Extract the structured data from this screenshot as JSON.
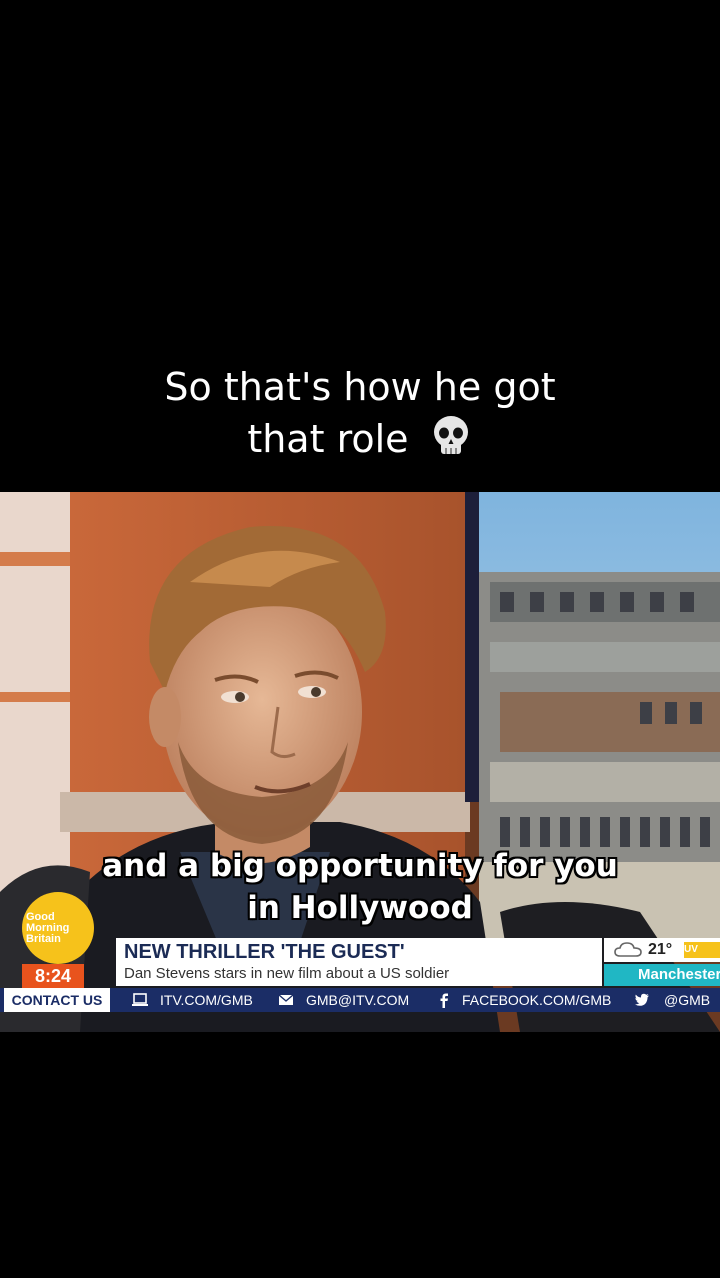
{
  "caption": {
    "line1": "So that's how he got",
    "line2": "that role",
    "emoji_icon": "skull-icon"
  },
  "video": {
    "subtitle_line1": "and a big opportunity for you",
    "subtitle_line2": "in Hollywood",
    "show_logo": "Good Morning Britain",
    "clock": "8:24",
    "headline": "NEW THRILLER 'THE GUEST'",
    "strapline": "Dan Stevens stars in new film about a US soldier",
    "weather_temp": "21°",
    "weather_icon": "cloud-icon",
    "uv_label": "UV",
    "city": "Manchester",
    "ticker": {
      "contact": "CONTACT US",
      "web": "ITV.COM/GMB",
      "email": "GMB@ITV.COM",
      "facebook": "FACEBOOK.COM/GMB",
      "twitter": "@GMB"
    },
    "colors": {
      "gmb_yellow": "#f6c21b",
      "gmb_orange": "#e8531d",
      "ticker_navy": "#1b2d66",
      "city_teal": "#20b7c4"
    }
  }
}
